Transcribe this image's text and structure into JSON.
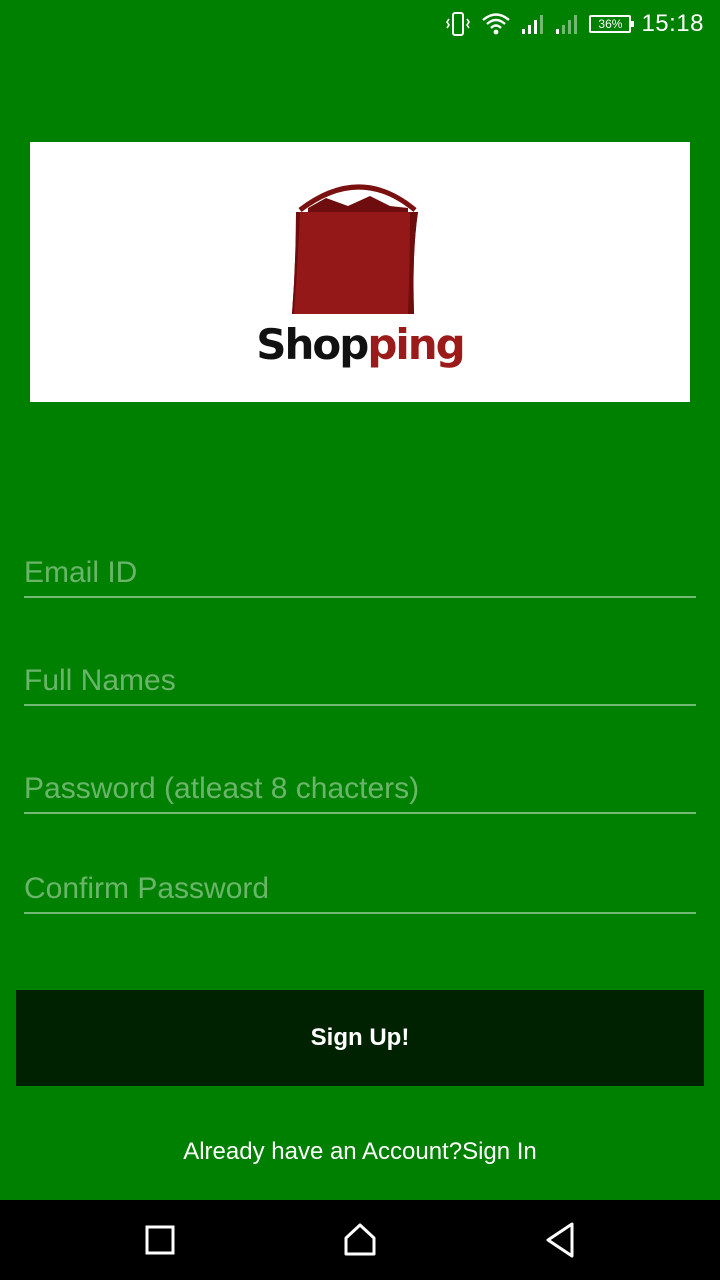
{
  "status_bar": {
    "battery": "36%",
    "time": "15:18",
    "icons": [
      "vibrate-icon",
      "wifi-icon",
      "signal-icon",
      "signal-weak-icon",
      "battery-icon"
    ]
  },
  "logo": {
    "word_part1": "Shop",
    "word_part2": "ping",
    "colors": {
      "bag": "#9b1b1b",
      "text_dark": "#111111"
    }
  },
  "form": {
    "email_placeholder": "Email ID",
    "fullname_placeholder": "Full Names",
    "password_placeholder": "Password (atleast 8 chacters)",
    "confirm_placeholder": "Confirm Password"
  },
  "signup_button": "Sign Up!",
  "signin_link": "Already have an Account?Sign In",
  "nav_bar": {
    "icons": [
      "recents-icon",
      "home-icon",
      "back-icon"
    ]
  },
  "colors": {
    "background": "#008000",
    "button": "#002200",
    "nav": "#000000"
  }
}
